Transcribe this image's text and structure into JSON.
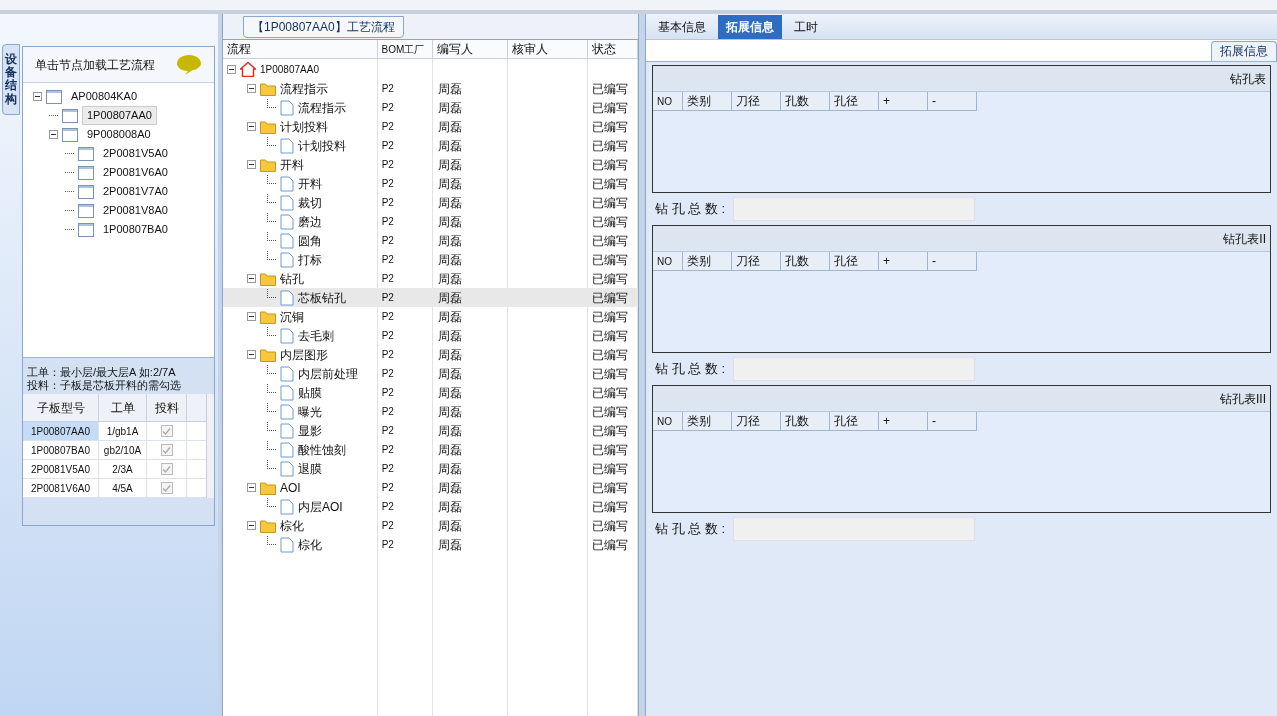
{
  "left_panel": {
    "side_tab": "设备结构",
    "hint": "单击节点加载工艺流程",
    "tree": [
      {
        "label": "AP00804KA0",
        "expanded": true,
        "selected": false,
        "children": [
          {
            "label": "1P00807AA0",
            "selected": true
          },
          {
            "label": "9P008008A0",
            "expanded": true,
            "selected": false,
            "children": [
              {
                "label": "2P0081V5A0",
                "selected": false
              },
              {
                "label": "2P0081V6A0",
                "selected": false
              },
              {
                "label": "2P0081V7A0",
                "selected": false
              },
              {
                "label": "2P0081V8A0",
                "selected": false
              },
              {
                "label": "1P00807BA0",
                "selected": false
              }
            ]
          }
        ]
      }
    ],
    "notes": [
      "工单：最小层/最大层A 如:2/7A",
      "投料：子板是芯板开料的需勾选"
    ],
    "table": {
      "columns": [
        "子板型号",
        "工单",
        "投料"
      ],
      "rows": [
        {
          "model": "1P00807AA0",
          "order": "1/gb1A",
          "checked": true,
          "selected": true
        },
        {
          "model": "1P00807BA0",
          "order": "gb2/10A",
          "checked": true,
          "selected": false
        },
        {
          "model": "2P0081V5A0",
          "order": "2/3A",
          "checked": true,
          "selected": false
        },
        {
          "model": "2P0081V6A0",
          "order": "4/5A",
          "checked": true,
          "selected": false
        }
      ]
    }
  },
  "flow_panel": {
    "title": "【1P00807AA0】工艺流程",
    "columns": [
      "流程",
      "BOM工厂",
      "编写人",
      "核审人",
      "状态"
    ],
    "tree": [
      {
        "label": "1P00807AA0",
        "kind": "root",
        "expanded": true,
        "selected": false,
        "children": [
          {
            "label": "流程指示",
            "kind": "folder",
            "factory": "P2",
            "author": "周磊",
            "status": "已编写",
            "expanded": true,
            "selected": false,
            "children": [
              {
                "label": "流程指示",
                "kind": "file",
                "factory": "P2",
                "author": "周磊",
                "status": "已编写",
                "selected": false
              }
            ]
          },
          {
            "label": "计划投料",
            "kind": "folder",
            "factory": "P2",
            "author": "周磊",
            "status": "已编写",
            "expanded": true,
            "selected": false,
            "children": [
              {
                "label": "计划投料",
                "kind": "file",
                "factory": "P2",
                "author": "周磊",
                "status": "已编写",
                "selected": false
              }
            ]
          },
          {
            "label": "开料",
            "kind": "folder",
            "factory": "P2",
            "author": "周磊",
            "status": "已编写",
            "expanded": true,
            "selected": false,
            "children": [
              {
                "label": "开料",
                "kind": "file",
                "factory": "P2",
                "author": "周磊",
                "status": "已编写",
                "selected": false
              },
              {
                "label": "裁切",
                "kind": "file",
                "factory": "P2",
                "author": "周磊",
                "status": "已编写",
                "selected": false
              },
              {
                "label": "磨边",
                "kind": "file",
                "factory": "P2",
                "author": "周磊",
                "status": "已编写",
                "selected": false
              },
              {
                "label": "圆角",
                "kind": "file",
                "factory": "P2",
                "author": "周磊",
                "status": "已编写",
                "selected": false
              },
              {
                "label": "打标",
                "kind": "file",
                "factory": "P2",
                "author": "周磊",
                "status": "已编写",
                "selected": false
              }
            ]
          },
          {
            "label": "钻孔",
            "kind": "folder",
            "factory": "P2",
            "author": "周磊",
            "status": "已编写",
            "expanded": true,
            "selected": false,
            "children": [
              {
                "label": "芯板钻孔",
                "kind": "file",
                "factory": "P2",
                "author": "周磊",
                "status": "已编写",
                "selected": true
              }
            ]
          },
          {
            "label": "沉铜",
            "kind": "folder",
            "factory": "P2",
            "author": "周磊",
            "status": "已编写",
            "expanded": true,
            "selected": false,
            "children": [
              {
                "label": "去毛刺",
                "kind": "file",
                "factory": "P2",
                "author": "周磊",
                "status": "已编写",
                "selected": false
              }
            ]
          },
          {
            "label": "内层图形",
            "kind": "folder",
            "factory": "P2",
            "author": "周磊",
            "status": "已编写",
            "expanded": true,
            "selected": false,
            "children": [
              {
                "label": "内层前处理",
                "kind": "file",
                "factory": "P2",
                "author": "周磊",
                "status": "已编写",
                "selected": false
              },
              {
                "label": "贴膜",
                "kind": "file",
                "factory": "P2",
                "author": "周磊",
                "status": "已编写",
                "selected": false
              },
              {
                "label": "曝光",
                "kind": "file",
                "factory": "P2",
                "author": "周磊",
                "status": "已编写",
                "selected": false
              },
              {
                "label": "显影",
                "kind": "file",
                "factory": "P2",
                "author": "周磊",
                "status": "已编写",
                "selected": false
              },
              {
                "label": "酸性蚀刻",
                "kind": "file",
                "factory": "P2",
                "author": "周磊",
                "status": "已编写",
                "selected": false
              },
              {
                "label": "退膜",
                "kind": "file",
                "factory": "P2",
                "author": "周磊",
                "status": "已编写",
                "selected": false
              }
            ]
          },
          {
            "label": "AOI",
            "kind": "folder",
            "factory": "P2",
            "author": "周磊",
            "status": "已编写",
            "expanded": true,
            "selected": false,
            "children": [
              {
                "label": "内层AOI",
                "kind": "file",
                "factory": "P2",
                "author": "周磊",
                "status": "已编写",
                "selected": false
              }
            ]
          },
          {
            "label": "棕化",
            "kind": "folder",
            "factory": "P2",
            "author": "周磊",
            "status": "已编写",
            "expanded": true,
            "selected": false,
            "children": [
              {
                "label": "棕化",
                "kind": "file",
                "factory": "P2",
                "author": "周磊",
                "status": "已编写",
                "selected": false
              }
            ]
          }
        ]
      }
    ]
  },
  "right_panel": {
    "tabs": [
      {
        "label": "基本信息",
        "selected": false
      },
      {
        "label": "拓展信息",
        "selected": true
      },
      {
        "label": "工时",
        "selected": false
      }
    ],
    "section_tab": "拓展信息",
    "drill_tables": [
      {
        "title": "钻孔表",
        "columns": [
          "NO",
          "类别",
          "刀径",
          "孔数",
          "孔径",
          "+",
          "-"
        ],
        "total_label": "钻 孔 总 数 :"
      },
      {
        "title": "钻孔表II",
        "columns": [
          "NO",
          "类别",
          "刀径",
          "孔数",
          "孔径",
          "+",
          "-"
        ],
        "total_label": "钻 孔 总 数 :"
      },
      {
        "title": "钻孔表III",
        "columns": [
          "NO",
          "类别",
          "刀径",
          "孔数",
          "孔径",
          "+",
          "-"
        ],
        "total_label": "钻 孔 总 数 :"
      }
    ]
  }
}
